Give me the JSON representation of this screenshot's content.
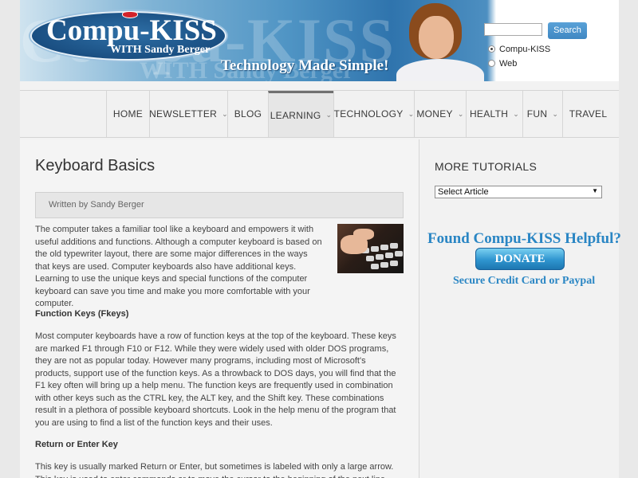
{
  "header": {
    "logo_text": "Compu-KISS",
    "logo_sub": "WITH Sandy Berger",
    "watermark_main": "Compu-KISS",
    "watermark_sub": "WITH Sandy Berger",
    "tagline": "Technology Made Simple!",
    "search": {
      "value": "",
      "button_label": "Search"
    },
    "radio_options": [
      {
        "label": "Compu-KISS",
        "selected": true
      },
      {
        "label": "Web",
        "selected": false
      }
    ]
  },
  "nav": {
    "items": [
      {
        "label": "HOME",
        "has_dropdown": false
      },
      {
        "label": "NEWSLETTER",
        "has_dropdown": true
      },
      {
        "label": "BLOG",
        "has_dropdown": false
      },
      {
        "label": "LEARNING",
        "has_dropdown": true,
        "active": true
      },
      {
        "label": "TECHNOLOGY",
        "has_dropdown": true
      },
      {
        "label": "MONEY",
        "has_dropdown": true
      },
      {
        "label": "HEALTH",
        "has_dropdown": true
      },
      {
        "label": "FUN",
        "has_dropdown": true
      },
      {
        "label": "TRAVEL",
        "has_dropdown": false
      }
    ],
    "chevron": "⌄"
  },
  "article": {
    "title": "Keyboard Basics",
    "byline": "Written by Sandy Berger",
    "intro": "The computer takes a familiar tool like a keyboard and empowers it with useful additions and functions. Although a computer keyboard is based on the old typewriter layout, there are some major differences in the ways that keys are used. Computer keyboards also have additional keys. Learning to use the unique keys and special functions of the computer keyboard can save you time and make you more comfortable with your computer.",
    "section1_title": "Function Keys (Fkeys)",
    "section1_text": "Most computer keyboards have a row of function keys at the top of the keyboard. These keys are marked F1 through F10 or F12. While they were widely used with older DOS programs, they are not as popular today. However many programs, including most of Microsoft's products, support use of the function keys. As a throwback to DOS days, you will find that the F1 key often will bring up a help menu. The function keys are frequently used in combination with other keys such as the CTRL key, the ALT key, and the Shift key. These combinations result in a plethora of possible keyboard shortcuts. Look in the help menu of the program that you are using to find a list of the function keys and their uses.",
    "section2_title": "Return or Enter Key",
    "section2_text": "This key is usually marked Return or Enter, but sometimes is labeled with only a large arrow. This key is used to enter commands or to move the cursor to the beginning of the next line. Also, in every"
  },
  "sidebar": {
    "heading": "MORE TUTORIALS",
    "select_value": "Select Article",
    "select_arrow": "▼",
    "promo_heading": "Found Compu-KISS Helpful?",
    "donate_label": "DONATE",
    "promo_sub": "Secure Credit Card or Paypal"
  }
}
